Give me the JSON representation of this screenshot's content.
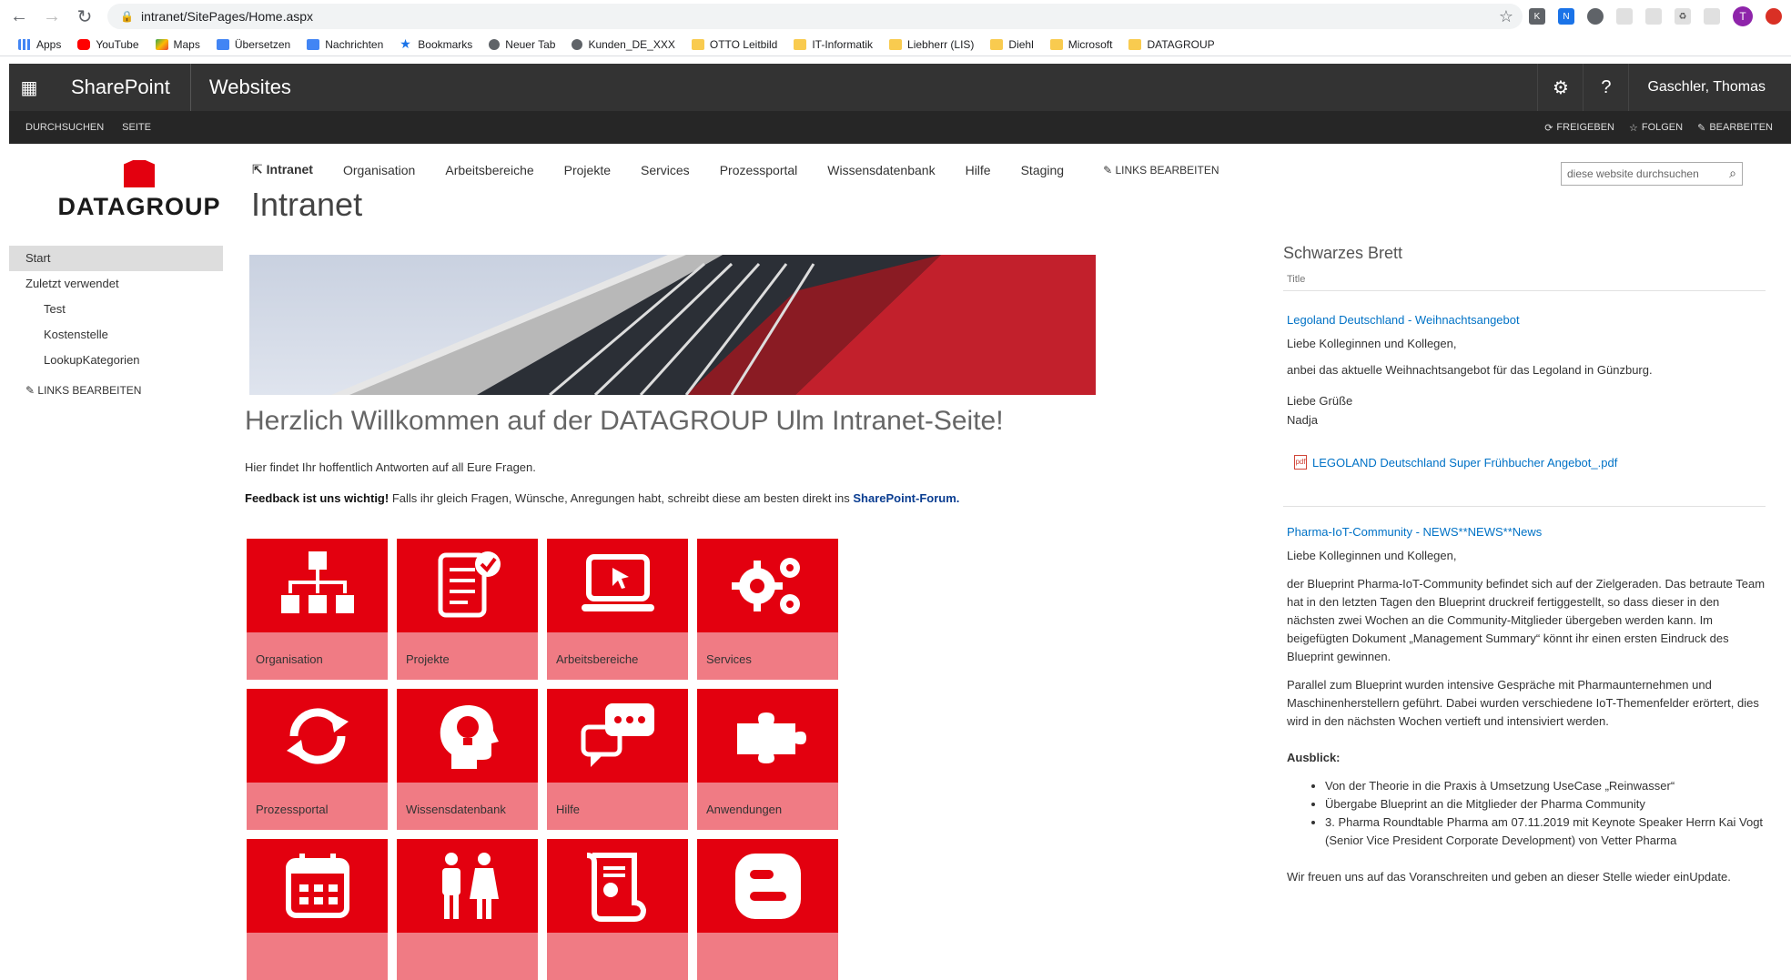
{
  "browser": {
    "url": "intranet/SitePages/Home.aspx",
    "bookmarks": [
      "Apps",
      "YouTube",
      "Maps",
      "Übersetzen",
      "Nachrichten",
      "Bookmarks",
      "Neuer Tab",
      "Kunden_DE_XXX",
      "OTTO Leitbild",
      "IT-Informatik",
      "Liebherr (LIS)",
      "Diehl",
      "Microsoft",
      "DATAGROUP"
    ]
  },
  "suitebar": {
    "brand": "SharePoint",
    "sites": "Websites",
    "user": "Gaschler, Thomas"
  },
  "ribbon": {
    "tabs": [
      "DURCHSUCHEN",
      "SEITE"
    ],
    "actions": [
      "FREIGEBEN",
      "FOLGEN",
      "BEARBEITEN"
    ]
  },
  "logo": {
    "text": "DATAGROUP"
  },
  "topnav": {
    "items": [
      "Intranet",
      "Organisation",
      "Arbeitsbereiche",
      "Projekte",
      "Services",
      "Prozessportal",
      "Wissensdatenbank",
      "Hilfe",
      "Staging"
    ],
    "edit": "LINKS BEARBEITEN"
  },
  "page": {
    "title": "Intranet",
    "search_placeholder": "diese website durchsuchen",
    "welcome": "Herzlich Willkommen auf der DATAGROUP Ulm Intranet-Seite!",
    "intro": "Hier findet Ihr hoffentlich Antworten auf all Eure Fragen.",
    "feedback_bold": "Feedback ist uns wichtig!",
    "feedback_text": " Falls ihr gleich Fragen, Wünsche, Anregungen habt, schreibt diese am besten direkt ins ",
    "feedback_link": "SharePoint-Forum."
  },
  "quicklaunch": {
    "items": [
      "Start",
      "Zuletzt verwendet",
      "Test",
      "Kostenstelle",
      "LookupKategorien"
    ],
    "edit": "LINKS BEARBEITEN"
  },
  "tiles": [
    "Organisation",
    "Projekte",
    "Arbeitsbereiche",
    "Services",
    "Prozessportal",
    "Wissensdatenbank",
    "Hilfe",
    "Anwendungen",
    "",
    "",
    "",
    ""
  ],
  "board": {
    "title": "Schwarzes Brett",
    "column": "Title",
    "n1_title": "Legoland Deutschland - Weihnachtsangebot",
    "n1_p1": "Liebe Kolleginnen und Kollegen,",
    "n1_p2": "anbei das aktuelle Weihnachtsangebot für das Legoland in Günzburg.",
    "n1_p3": "Liebe Grüße",
    "n1_p4": "Nadja",
    "n1_pdf": "LEGOLAND Deutschland Super Frühbucher Angebot_.pdf",
    "n2_title": "Pharma-IoT-Community - NEWS**NEWS**News",
    "n2_p1": "Liebe Kolleginnen und Kollegen,",
    "n2_p2": "der Blueprint Pharma-IoT-Community befindet sich auf der Zielgeraden. Das betraute Team hat in den letzten Tagen den Blueprint druckreif fertiggestellt, so dass dieser in den nächsten zwei Wochen an die Community-Mitglieder übergeben werden kann. Im beigefügten Dokument „Management Summary“ könnt ihr einen ersten Eindruck des Blueprint gewinnen.",
    "n2_p3": "Parallel zum Blueprint wurden intensive Gespräche mit Pharmaunternehmen und Maschinenherstellern geführt. Dabei wurden verschiedene IoT-Themenfelder erörtert, dies wird in den nächsten Wochen vertieft und intensiviert werden.",
    "n2_ausblick": "Ausblick:",
    "n2_bullets": [
      "Von der Theorie in die Praxis à Umsetzung UseCase „Reinwasser“",
      "Übergabe Blueprint an die Mitglieder der Pharma Community",
      "3. Pharma Roundtable Pharma am 07.11.2019 mit Keynote Speaker Herrn Kai Vogt (Senior Vice President Corporate Development) von Vetter Pharma"
    ],
    "n2_closing": "Wir freuen uns auf das Voranschreiten und geben an dieser Stelle wieder einUpdate."
  },
  "colors": {
    "accent": "#e3000f",
    "tile_label": "#f07b84",
    "suitebar": "#333333",
    "link": "#0072c6"
  }
}
